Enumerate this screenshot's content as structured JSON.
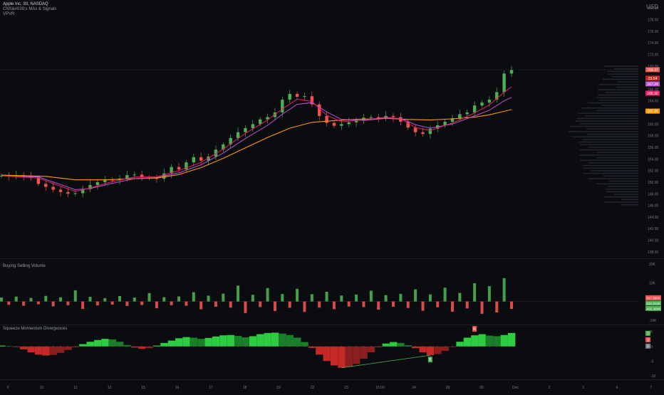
{
  "header": {
    "title": "Apple Inc, 30, NASDAQ",
    "indicator_1": "CNS&#039;s MAs & Signals",
    "indicator_2": "VPVR",
    "currency": "USD"
  },
  "panes": {
    "volume_title": "Buying Selling Volume",
    "momentum_title": "Squeeze Momentum Divergences"
  },
  "colors": {
    "background": "#0b0c10",
    "bull": "#4caf50",
    "bear": "#ef5350",
    "ma_fast": "#e91e63",
    "ma_mid": "#ba55d3",
    "ma_slow": "#ff9800",
    "grid": "#161821",
    "text": "#787b86"
  },
  "chart_data": [
    {
      "type": "line",
      "name": "price",
      "x_ticks": [
        "9",
        "10",
        "11",
        "12",
        "15",
        "16",
        "17",
        "18",
        "19",
        "22",
        "23",
        "15:00",
        "24",
        "29",
        "30",
        "Dec",
        "2",
        "3",
        "6",
        "7"
      ],
      "y_ticks": [
        138.0,
        140.0,
        142.0,
        144.0,
        146.0,
        148.0,
        150.0,
        152.0,
        154.0,
        156.0,
        158.0,
        160.0,
        162.0,
        164.0,
        166.0,
        168.0,
        170.0,
        172.0,
        174.0,
        176.0,
        178.0,
        180.0
      ],
      "ylim": [
        137,
        181
      ],
      "price_path": [
        [
          0,
          151.1
        ],
        [
          1,
          151.0
        ],
        [
          2,
          151.2
        ],
        [
          3,
          151.1
        ],
        [
          4,
          150.8
        ],
        [
          5,
          149.7
        ],
        [
          6,
          149.2
        ],
        [
          7,
          148.7
        ],
        [
          8,
          148.3
        ],
        [
          9,
          148.0
        ],
        [
          10,
          148.1
        ],
        [
          11,
          148.8
        ],
        [
          12,
          149.5
        ],
        [
          13,
          150.0
        ],
        [
          14,
          150.4
        ],
        [
          15,
          150.3
        ],
        [
          16,
          150.6
        ],
        [
          17,
          151.2
        ],
        [
          18,
          151.3
        ],
        [
          19,
          150.8
        ],
        [
          20,
          150.7
        ],
        [
          21,
          150.6
        ],
        [
          22,
          151.5
        ],
        [
          23,
          152.6
        ],
        [
          24,
          152.2
        ],
        [
          25,
          153.4
        ],
        [
          26,
          154.3
        ],
        [
          27,
          153.7
        ],
        [
          28,
          154.4
        ],
        [
          29,
          155.6
        ],
        [
          30,
          156.5
        ],
        [
          31,
          157.6
        ],
        [
          32,
          158.6
        ],
        [
          33,
          159.3
        ],
        [
          34,
          160.0
        ],
        [
          35,
          160.8
        ],
        [
          36,
          161.2
        ],
        [
          37,
          162.0
        ],
        [
          38,
          164.2
        ],
        [
          39,
          165.2
        ],
        [
          40,
          164.7
        ],
        [
          41,
          164.8
        ],
        [
          42,
          163.4
        ],
        [
          43,
          161.4
        ],
        [
          44,
          160.2
        ],
        [
          45,
          159.7
        ],
        [
          46,
          160.0
        ],
        [
          47,
          160.3
        ],
        [
          48,
          160.6
        ],
        [
          49,
          161.1
        ],
        [
          50,
          161.2
        ],
        [
          51,
          161.0
        ],
        [
          52,
          161.4
        ],
        [
          53,
          161.2
        ],
        [
          54,
          160.4
        ],
        [
          55,
          159.4
        ],
        [
          56,
          158.6
        ],
        [
          57,
          158.3
        ],
        [
          58,
          159.2
        ],
        [
          59,
          159.8
        ],
        [
          60,
          160.4
        ],
        [
          61,
          161.0
        ],
        [
          62,
          161.7
        ],
        [
          63,
          162.0
        ],
        [
          64,
          163.2
        ],
        [
          65,
          163.7
        ],
        [
          66,
          164.2
        ],
        [
          67,
          165.5
        ],
        [
          68,
          168.7
        ],
        [
          69,
          169.3
        ]
      ],
      "ma_fast": [
        [
          0,
          151.1
        ],
        [
          5,
          150.7
        ],
        [
          8,
          149.3
        ],
        [
          10,
          148.4
        ],
        [
          12,
          149.0
        ],
        [
          15,
          150.1
        ],
        [
          18,
          150.9
        ],
        [
          21,
          150.9
        ],
        [
          24,
          152.0
        ],
        [
          27,
          153.4
        ],
        [
          30,
          155.7
        ],
        [
          33,
          158.4
        ],
        [
          36,
          160.7
        ],
        [
          38,
          162.6
        ],
        [
          40,
          164.3
        ],
        [
          42,
          163.9
        ],
        [
          44,
          161.5
        ],
        [
          46,
          160.4
        ],
        [
          49,
          160.7
        ],
        [
          52,
          161.2
        ],
        [
          54,
          160.9
        ],
        [
          56,
          159.4
        ],
        [
          58,
          158.9
        ],
        [
          61,
          160.2
        ],
        [
          64,
          161.9
        ],
        [
          66,
          163.3
        ],
        [
          68,
          165.5
        ],
        [
          69,
          166.4
        ]
      ],
      "ma_mid": [
        [
          0,
          151.1
        ],
        [
          5,
          150.9
        ],
        [
          8,
          149.6
        ],
        [
          10,
          148.7
        ],
        [
          12,
          148.9
        ],
        [
          15,
          149.8
        ],
        [
          18,
          150.6
        ],
        [
          21,
          150.8
        ],
        [
          24,
          151.6
        ],
        [
          27,
          153.0
        ],
        [
          30,
          155.0
        ],
        [
          33,
          157.5
        ],
        [
          36,
          159.8
        ],
        [
          38,
          161.7
        ],
        [
          40,
          163.4
        ],
        [
          42,
          163.7
        ],
        [
          44,
          162.1
        ],
        [
          46,
          160.8
        ],
        [
          49,
          160.6
        ],
        [
          52,
          161.0
        ],
        [
          54,
          161.0
        ],
        [
          56,
          159.9
        ],
        [
          58,
          159.3
        ],
        [
          61,
          160.0
        ],
        [
          64,
          161.4
        ],
        [
          66,
          162.4
        ],
        [
          68,
          164.0
        ],
        [
          69,
          164.6
        ]
      ],
      "ma_slow": [
        [
          0,
          151.2
        ],
        [
          6,
          151.0
        ],
        [
          10,
          150.4
        ],
        [
          14,
          150.4
        ],
        [
          18,
          150.6
        ],
        [
          21,
          150.7
        ],
        [
          24,
          151.3
        ],
        [
          27,
          152.5
        ],
        [
          30,
          154.1
        ],
        [
          33,
          155.9
        ],
        [
          36,
          157.7
        ],
        [
          39,
          159.3
        ],
        [
          42,
          160.3
        ],
        [
          45,
          160.6
        ],
        [
          48,
          160.8
        ],
        [
          52,
          161.0
        ],
        [
          55,
          160.8
        ],
        [
          58,
          160.7
        ],
        [
          61,
          160.9
        ],
        [
          64,
          161.2
        ],
        [
          66,
          161.6
        ],
        [
          68,
          162.2
        ],
        [
          69,
          162.5
        ]
      ],
      "labels": [
        "169.37",
        "23.54",
        "167.24",
        "165.32",
        "162.24"
      ],
      "label_values": [
        169.37,
        167.9,
        167.24,
        165.32,
        162.24
      ],
      "label_colors": [
        "#ef5350",
        "#c62828",
        "#ba55d3",
        "#e91e63",
        "#ff9800"
      ]
    },
    {
      "type": "bar",
      "name": "buying-selling-volume",
      "y_ticks": [
        "20K",
        "10K",
        "-10K"
      ],
      "y_tick_values": [
        20000,
        10000,
        -10000
      ],
      "ylim": [
        -12000,
        22000
      ],
      "values": [
        2100,
        -1800,
        2600,
        -2300,
        1900,
        -1500,
        3000,
        -2600,
        2200,
        -2000,
        6000,
        -4000,
        2500,
        -2100,
        1800,
        -1700,
        2900,
        -2400,
        2100,
        -1900,
        4500,
        -3600,
        2300,
        -2000,
        2700,
        -2300,
        5000,
        -4200,
        3100,
        -2800,
        4200,
        -3300,
        8500,
        -6200,
        3600,
        -3000,
        7200,
        -5100,
        4000,
        -3400,
        6800,
        -5600,
        3900,
        -3300,
        5200,
        -4100,
        3200,
        -2700,
        3700,
        -3000,
        5800,
        -4400,
        3400,
        -2800,
        4100,
        -3500,
        6500,
        -5000,
        3800,
        -3100,
        7400,
        -5500,
        4600,
        -3700,
        9800,
        -6600,
        8200,
        -5900,
        12500,
        -4000
      ],
      "labels": [
        "107.386K",
        "324.204K",
        "-402.484K"
      ],
      "label_colors": [
        "#ef5350",
        "#4caf50",
        "#4caf50"
      ]
    },
    {
      "type": "bar",
      "name": "squeeze-momentum",
      "y_ticks": [
        "5",
        "0",
        "-5",
        "-10"
      ],
      "y_tick_values": [
        5,
        0,
        -5,
        -10
      ],
      "ylim": [
        -11,
        7
      ],
      "values": [
        0.3,
        0.1,
        -0.2,
        -1.0,
        -2.0,
        -2.8,
        -3.1,
        -2.9,
        -2.2,
        -1.2,
        -0.3,
        0.8,
        1.6,
        2.2,
        2.6,
        2.4,
        1.6,
        0.5,
        -0.4,
        -0.8,
        -0.6,
        0.3,
        1.2,
        2.0,
        2.8,
        3.2,
        3.0,
        2.6,
        2.9,
        3.4,
        3.8,
        3.9,
        3.6,
        3.1,
        3.5,
        4.2,
        4.6,
        4.7,
        4.4,
        3.9,
        3.0,
        1.5,
        -0.5,
        -2.8,
        -5.0,
        -6.5,
        -7.3,
        -7.0,
        -6.0,
        -4.2,
        -2.0,
        -0.3,
        1.0,
        1.5,
        1.2,
        0.4,
        -0.6,
        -2.0,
        -3.0,
        -2.6,
        -1.5,
        -0.2,
        1.6,
        3.0,
        3.8,
        4.2,
        3.7,
        3.5,
        3.9,
        4.6
      ],
      "markers": [
        {
          "label": "B",
          "index": 58,
          "color": "#4caf50"
        },
        {
          "label": "R",
          "index": 64,
          "color": "#ef5350"
        }
      ],
      "right_labels": [
        "2",
        "3",
        "0"
      ],
      "right_label_colors": [
        "#4caf50",
        "#ef5350",
        "#787b86"
      ]
    }
  ]
}
